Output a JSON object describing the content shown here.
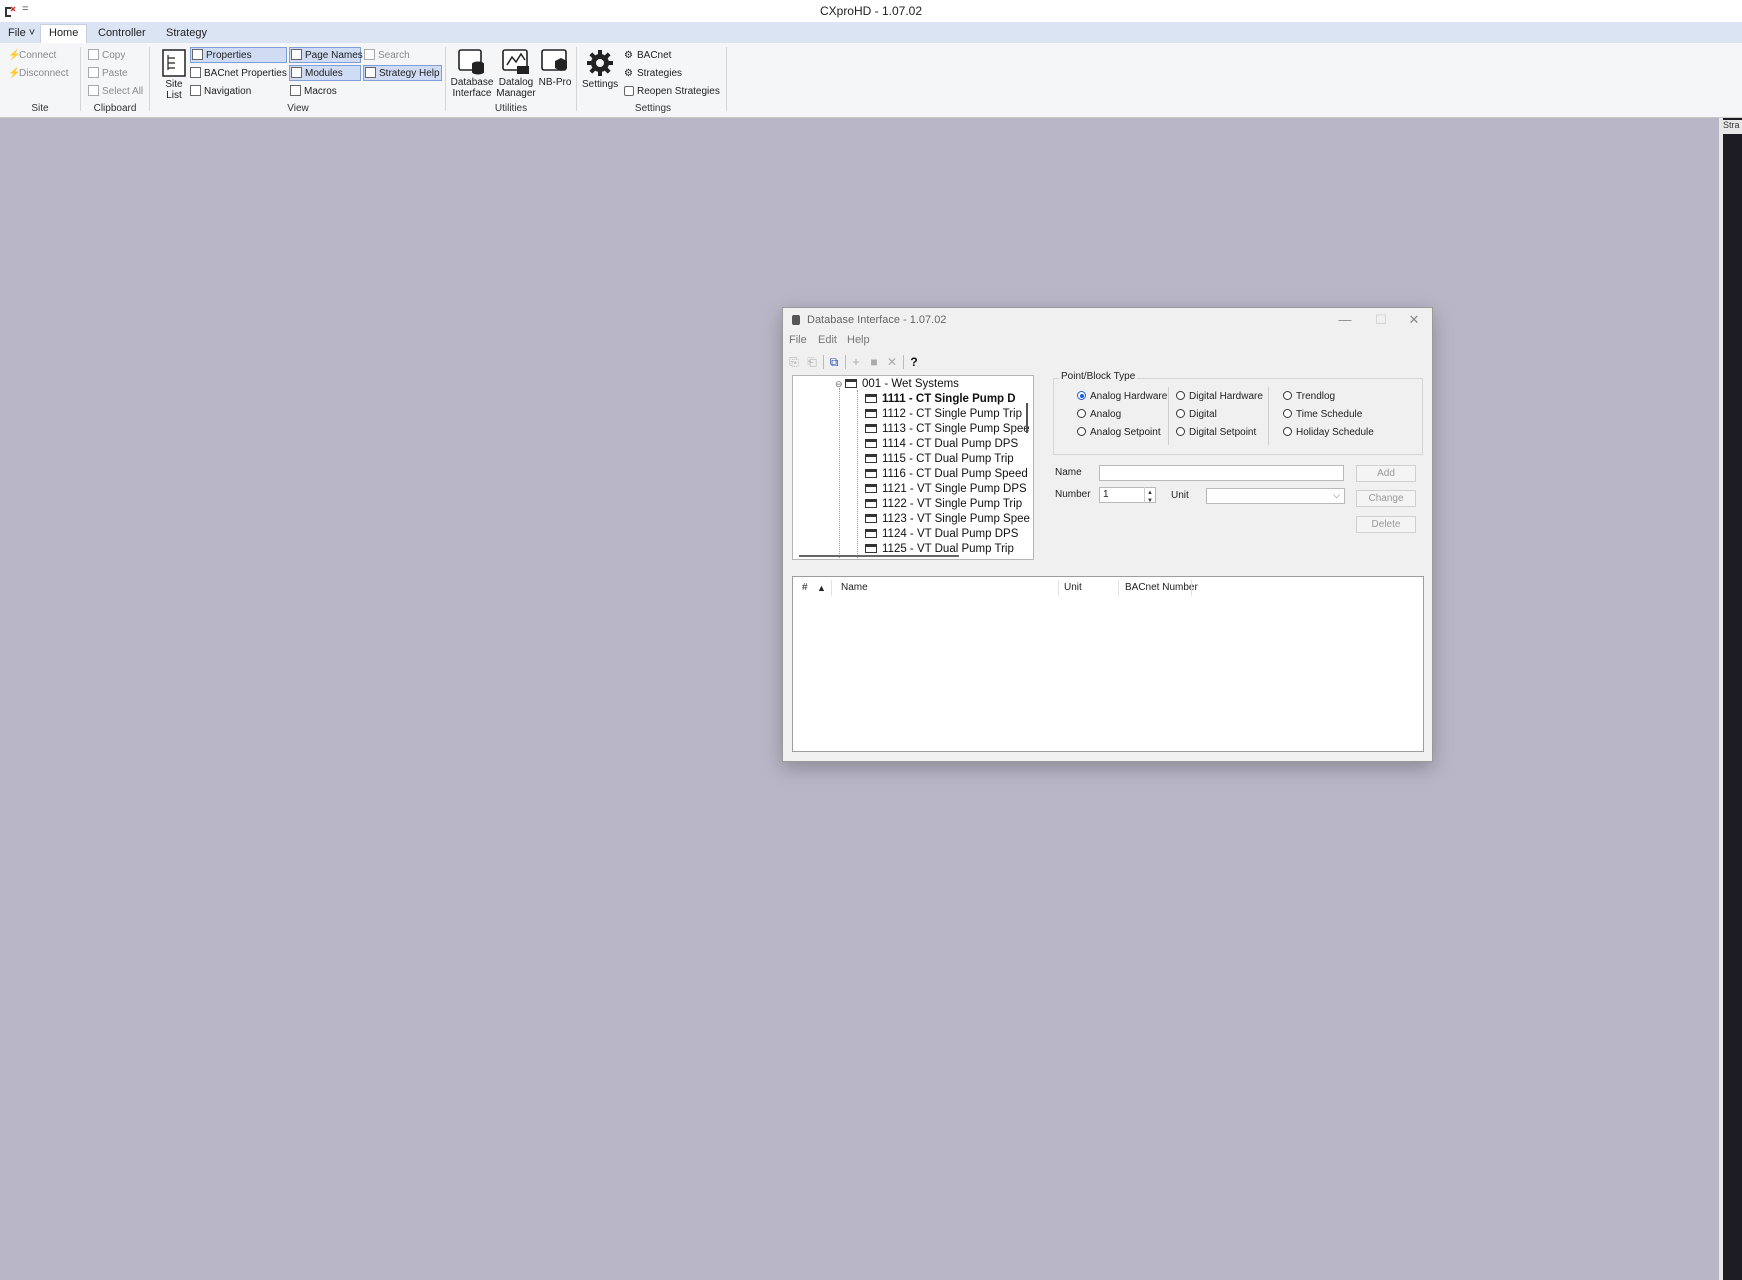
{
  "app": {
    "title": "CXproHD - 1.07.02",
    "quick_access": "="
  },
  "ribbon_tabs": [
    {
      "label": "File ˅"
    },
    {
      "label": "Home"
    },
    {
      "label": "Controller"
    },
    {
      "label": "Strategy"
    }
  ],
  "ribbon": {
    "site": {
      "group_label": "Site",
      "connect": "Connect",
      "disconnect": "Disconnect"
    },
    "clipboard": {
      "group_label": "Clipboard",
      "copy": "Copy",
      "paste": "Paste",
      "select_all": "Select All"
    },
    "view": {
      "group_label": "View",
      "site_list": "Site\nList",
      "site_list_line1": "Site",
      "site_list_line2": "List",
      "properties": "Properties",
      "bacnet_properties": "BACnet Properties",
      "navigation": "Navigation",
      "page_names": "Page Names",
      "modules": "Modules",
      "macros": "Macros",
      "search": "Search",
      "strategy_help": "Strategy Help"
    },
    "utilities": {
      "group_label": "Utilities",
      "database_interface_line1": "Database",
      "database_interface_line2": "Interface",
      "datalog_manager_line1": "Datalog",
      "datalog_manager_line2": "Manager",
      "nb_pro": "NB-Pro"
    },
    "settings": {
      "group_label": "Settings",
      "settings": "Settings",
      "bacnet": "BACnet",
      "strategies": "Strategies",
      "reopen_strategies": "Reopen Strategies"
    }
  },
  "right_panel": {
    "header": "Stra"
  },
  "dialog": {
    "title": "Database Interface - 1.07.02",
    "menu": [
      "File",
      "Edit",
      "Help"
    ],
    "tree": {
      "root": "001 - Wet Systems",
      "items": [
        {
          "label": "1111 - CT Single Pump D",
          "bold": true
        },
        {
          "label": "1112 - CT Single Pump Trip"
        },
        {
          "label": "1113 - CT Single Pump Spee"
        },
        {
          "label": "1114 - CT Dual Pump DPS"
        },
        {
          "label": "1115 - CT Dual Pump Trip"
        },
        {
          "label": "1116 - CT Dual Pump Speed"
        },
        {
          "label": "1121 - VT Single Pump DPS"
        },
        {
          "label": "1122 - VT Single Pump Trip"
        },
        {
          "label": "1123 - VT Single Pump Spee"
        },
        {
          "label": "1124 - VT Dual Pump DPS"
        },
        {
          "label": "1125 - VT Dual Pump Trip"
        }
      ]
    },
    "point_block_type": {
      "legend": "Point/Block Type",
      "col1": [
        "Analog Hardware",
        "Analog",
        "Analog Setpoint"
      ],
      "col2": [
        "Digital Hardware",
        "Digital",
        "Digital Setpoint"
      ],
      "col3": [
        "Trendlog",
        "Time Schedule",
        "Holiday Schedule"
      ],
      "selected": "Analog Hardware"
    },
    "form": {
      "name_label": "Name",
      "name_value": "",
      "number_label": "Number",
      "number_value": "1",
      "unit_label": "Unit",
      "unit_value": "",
      "add": "Add",
      "change": "Change",
      "delete": "Delete"
    },
    "list": {
      "columns": [
        "#",
        "▲",
        "Name",
        "Unit",
        "BACnet Number"
      ],
      "rows": []
    }
  }
}
